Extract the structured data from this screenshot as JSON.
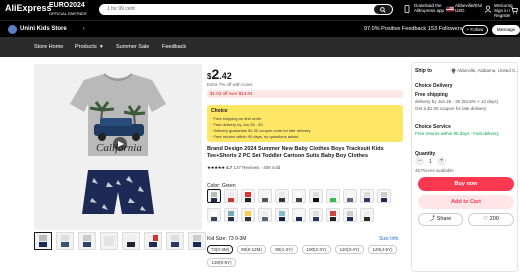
{
  "topbar": {
    "logo": "AliExpress",
    "event": "EURO2024",
    "event_sub": "OFFICIAL PARTNER",
    "search_placeholder": "1 for 99 cent",
    "app_line1": "Download the",
    "app_line2": "AliExpress app",
    "region_line1": "Abbeville/EN/",
    "region_line2": "USD",
    "account_line1": "Welcome",
    "account_line2": "Sign in / Register",
    "cart_count": "0"
  },
  "store": {
    "name": "Unini Kids Store",
    "positive_feedback": "97.0% Positive Feedback",
    "followers": "153 Followers",
    "follow_label": "+ Follow",
    "message_label": "Message"
  },
  "nav": {
    "items": [
      "Store Home",
      "Products",
      "Summer Sale",
      "Feedback"
    ]
  },
  "product": {
    "price_currency": "$",
    "price_whole": "2",
    "price_fraction": ".42",
    "tax_note": "Extra 7% off with coins",
    "coupon_text": "$1.03 off over $14.04",
    "choice_title": "Choice",
    "choice_lines": [
      "· Free shipping on first order",
      "· Fast delivery by Jun 26 - 30",
      "· Delivery guarantee  $1.00 coupon code for late delivery",
      "· Free returns  within 90 days, no questions asked"
    ],
    "title": "Brand Design 2024 Summer New Baby Clothes Boys Tracksuit Kids Tee+Shorts 2 PC Set Toddler Cartoon Suits Baby Boy Clothes",
    "rating_stars": "★★★★★",
    "rating_value": "4.7",
    "reviews": "137 Reviews",
    "sold": "458 sold",
    "color_label": "Color: Green",
    "size_label": "Kid Size: 73 0-3M",
    "size_info": "Size Info",
    "sizes": [
      "73(0-3M)",
      "80(6-12M)",
      "90(1-2Y)",
      "100(2-3Y)",
      "110(3-4Y)",
      "120(4-5Y)",
      "130(5-6Y)"
    ],
    "video_image_text": "California"
  },
  "panel": {
    "ship_to_label": "Ship to",
    "ship_to_value": "Abbeville, Alabama, United S...",
    "choice_delivery": "Choice Delivery",
    "free_shipping": "Free shipping",
    "delivery_line": "delivery by Jun 26 - 30 (94.8% < 12 days)",
    "coupon_line": "Get a $1.00 coupon for late delivery",
    "choice_service": "Choice Service",
    "free_returns": "Free returns within 90 days · Fast delivery",
    "quantity_label": "Quantity",
    "quantity_value": "1",
    "pieces": "45 Pieces available",
    "buy_now": "Buy now",
    "add_to_cart": "Add to Cart",
    "share": "Share",
    "wishlist_count": "200"
  },
  "colors": {
    "brand_red": "#fd384f",
    "choice_yellow": "#ffe766",
    "success_green": "#00a651"
  }
}
